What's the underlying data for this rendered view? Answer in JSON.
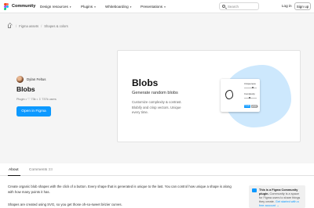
{
  "header": {
    "brand": "Community",
    "nav": [
      {
        "label": "Design resources"
      },
      {
        "label": "Plugins"
      },
      {
        "label": "Whiteboarding"
      },
      {
        "label": "Presentations"
      }
    ],
    "search_placeholder": "Search",
    "login_label": "Log in",
    "signup_label": "Sign up"
  },
  "breadcrumb": {
    "items": [
      "Figma assets",
      "Shapes & colors"
    ]
  },
  "plugin": {
    "author": "Dylan Feltus",
    "title": "Blobs",
    "meta": "Plugin • ♡ 73k • ⇩ 737k users",
    "open_button": "Open in Figma"
  },
  "hero": {
    "title": "Blobs",
    "subtitle": "Generate random blobs",
    "description": "Customize complexity & contrast. Blobify and crisp vectors. Unique every time.",
    "panel": {
      "label1": "Uniqueness",
      "label2": "Complexity",
      "button1": "Create",
      "button2": "Cancel"
    }
  },
  "tabs": [
    {
      "label": "About",
      "active": true
    },
    {
      "label": "Comments",
      "count": "33"
    }
  ],
  "about": {
    "paragraph1": "Create organic blob shapes with the click of a button. Every shape that is generated is unique to the last. You can control how unique a shape is along with how many points it has.",
    "paragraph2": "Shapes are created using SVG, so you get those oh-so-sweet bézier curves."
  },
  "notice": {
    "bold": "This is a Figma Community plugin.",
    "text": " Community is a space for Figma users to share things they create.",
    "link": "Get started with a free account →"
  }
}
